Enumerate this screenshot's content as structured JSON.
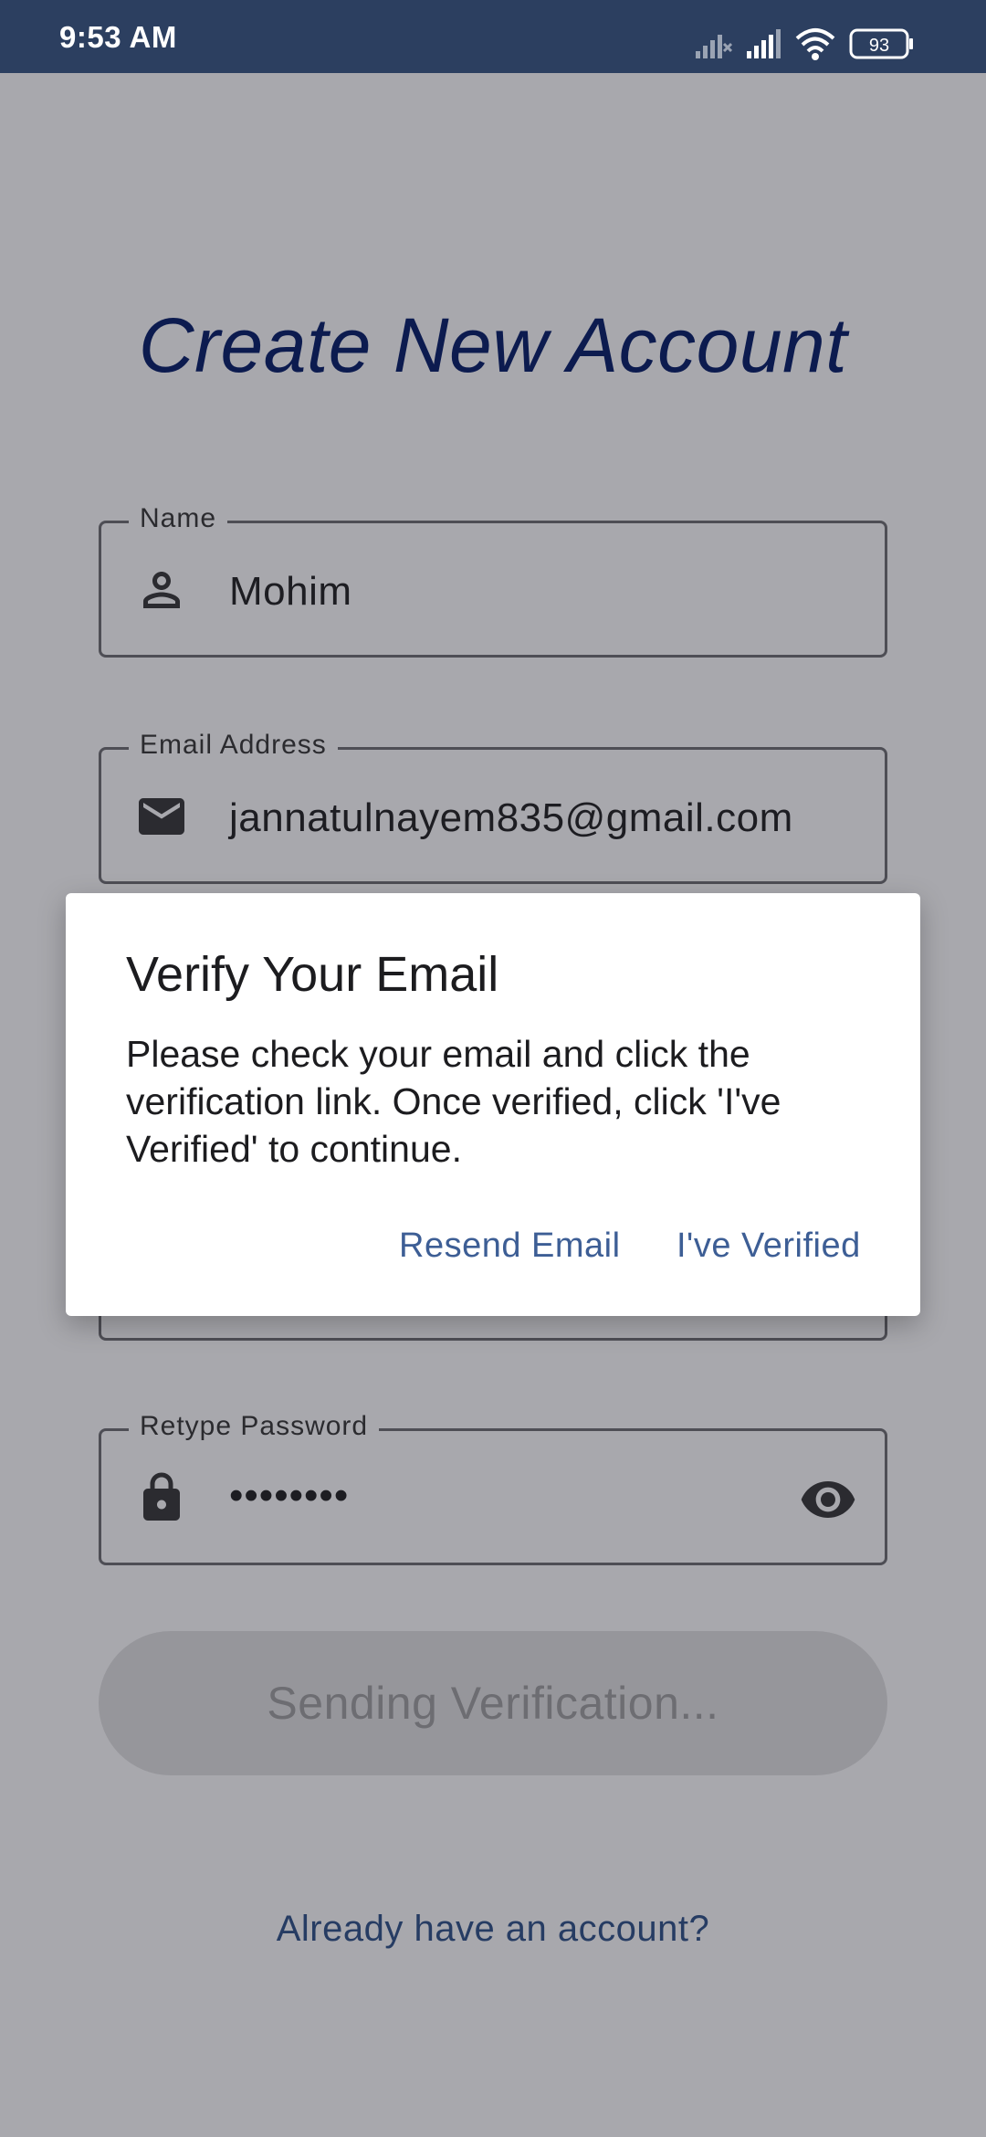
{
  "status_bar": {
    "time": "9:53 AM",
    "battery": "93"
  },
  "page": {
    "title": "Create New Account",
    "name_field": {
      "label": "Name",
      "value": "Mohim"
    },
    "email_field": {
      "label": "Email Address",
      "value": "jannatulnayem835@gmail.com"
    },
    "retype_password_field": {
      "label": "Retype Password",
      "value": "••••••••"
    },
    "send_button": "Sending Verification...",
    "login_link": "Already have an account?"
  },
  "dialog": {
    "title": "Verify Your Email",
    "body": "Please check your email and click the verification link. Once verified, click 'I've Verified' to continue.",
    "resend_label": "Resend Email",
    "verified_label": "I've Verified"
  },
  "colors": {
    "status_bar": "#2c3f60",
    "scrim_background": "#a8a8ad",
    "title": "#0c1b4f",
    "dialog_action": "#3d5e95",
    "link": "#263c63"
  }
}
